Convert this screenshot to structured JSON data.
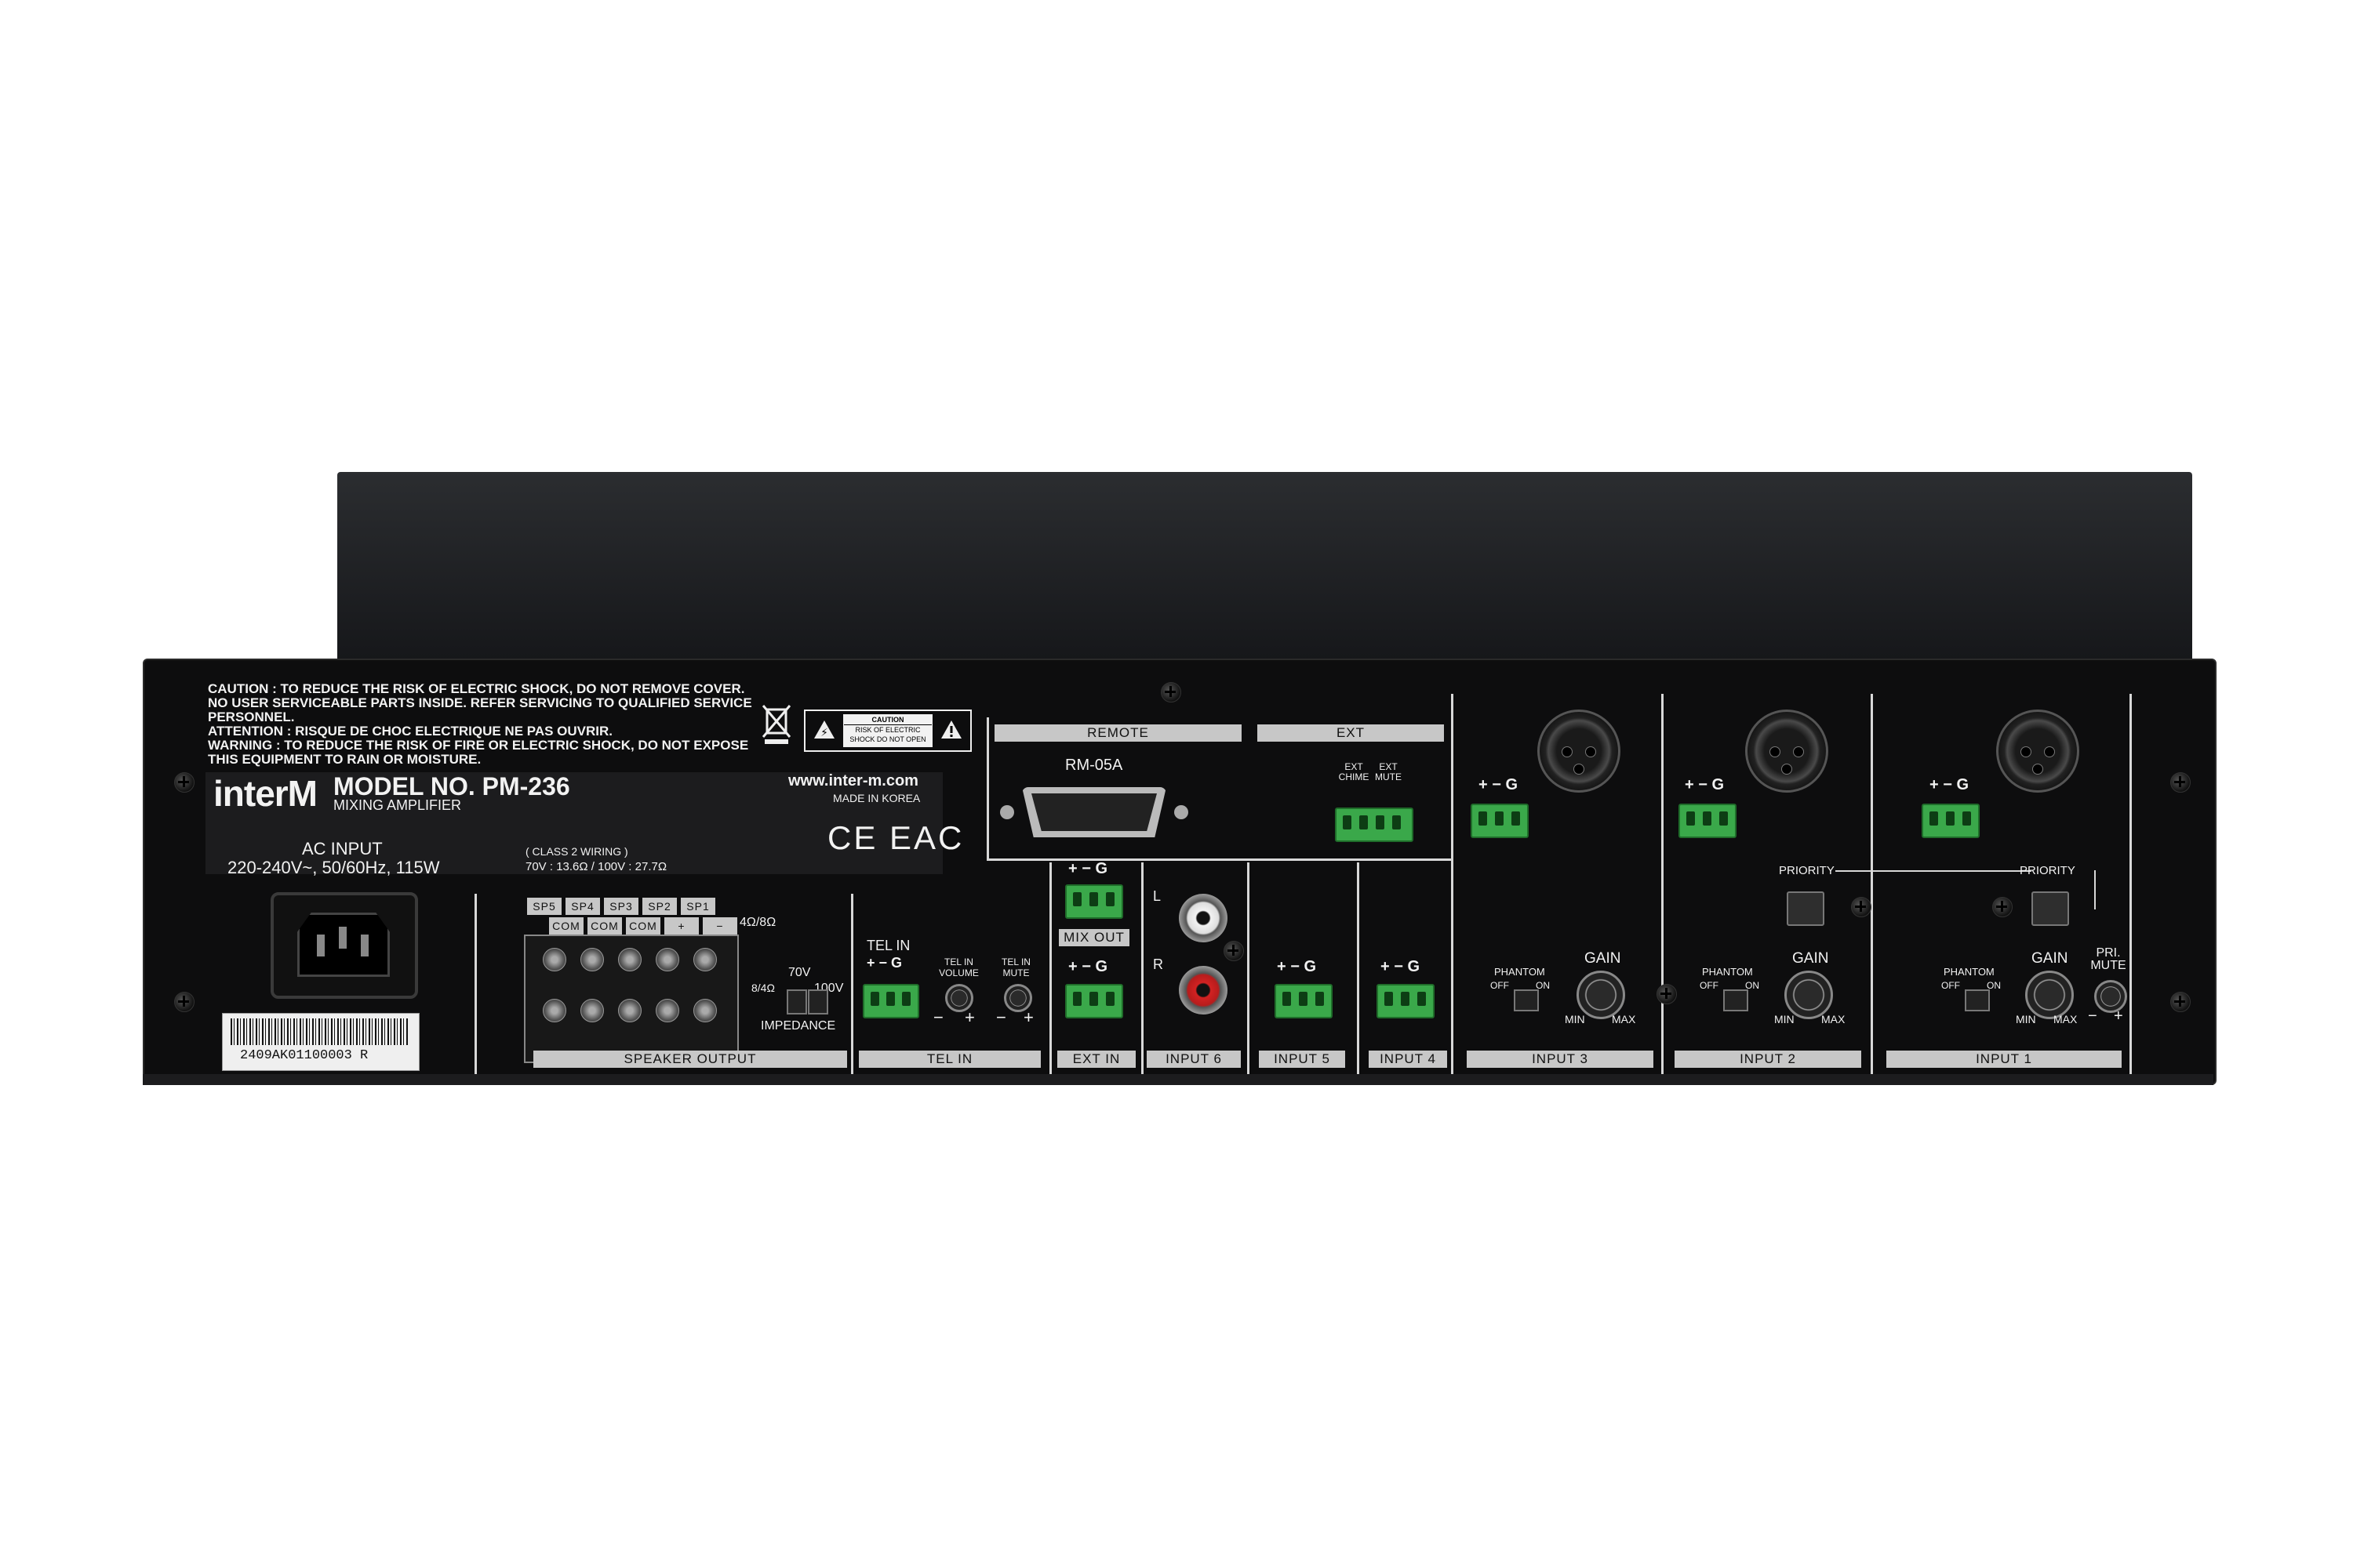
{
  "warnings": {
    "caution": "CAUTION : TO REDUCE THE RISK OF ELECTRIC SHOCK, DO NOT REMOVE COVER. NO USER SERVICEABLE PARTS INSIDE. REFER SERVICING TO QUALIFIED SERVICE PERSONNEL.",
    "attention": "ATTENTION : RISQUE DE CHOC ELECTRIQUE NE PAS OUVRIR.",
    "warning": "WARNING : TO REDUCE THE RISK OF FIRE OR ELECTRIC SHOCK, DO NOT EXPOSE THIS EQUIPMENT TO RAIN OR MOISTURE.",
    "caution_box_title": "CAUTION",
    "caution_box_text": "RISK OF ELECTRIC SHOCK DO NOT OPEN"
  },
  "brand": {
    "logo": "interM",
    "model": "MODEL NO. PM-236",
    "subtitle": "MIXING AMPLIFIER",
    "website": "www.inter-m.com",
    "origin": "MADE IN KOREA",
    "cert": "CE EAC"
  },
  "power": {
    "title": "AC INPUT",
    "spec": "220-240V~, 50/60Hz, 115W",
    "class": "( CLASS 2 WIRING )",
    "impedance_spec": "70V : 13.6Ω / 100V : 27.7Ω"
  },
  "serial": "2409AK01100003  R",
  "speaker": {
    "labels": [
      "SP5",
      "SP4",
      "SP3",
      "SP2",
      "SP1"
    ],
    "com": [
      "COM",
      "COM",
      "COM",
      "+",
      "−"
    ],
    "ohm": "4Ω/8Ω",
    "v70": "70V",
    "v100": "100V",
    "ohm_switch": "8/4Ω",
    "impedance": "IMPEDANCE",
    "section": "SPEAKER OUTPUT"
  },
  "telin": {
    "label": "TEL IN",
    "pins": "+ − G",
    "volume": "TEL IN VOLUME",
    "mute": "TEL IN MUTE",
    "minus": "−",
    "plus": "+",
    "section": "TEL IN"
  },
  "mixout": {
    "pins": "+ − G",
    "label": "MIX OUT"
  },
  "extin": {
    "pins": "+ − G",
    "section": "EXT IN"
  },
  "remote": {
    "section": "REMOTE",
    "port": "RM-05A"
  },
  "ext": {
    "section": "EXT",
    "chime": "EXT CHIME",
    "mute": "EXT MUTE"
  },
  "input6": {
    "left": "L",
    "right": "R",
    "section": "INPUT 6"
  },
  "input5": {
    "pins": "+ − G",
    "section": "INPUT 5"
  },
  "input4": {
    "pins": "+ − G",
    "section": "INPUT 4"
  },
  "input3": {
    "pins": "+ − G",
    "phantom": "PHANTOM",
    "off": "OFF",
    "on": "ON",
    "gain": "GAIN",
    "min": "MIN",
    "max": "MAX",
    "section": "INPUT 3"
  },
  "input2": {
    "pins": "+ − G",
    "phantom": "PHANTOM",
    "off": "OFF",
    "on": "ON",
    "gain": "GAIN",
    "min": "MIN",
    "max": "MAX",
    "priority": "PRIORITY",
    "section": "INPUT 2"
  },
  "input1": {
    "pins": "+ − G",
    "phantom": "PHANTOM",
    "off": "OFF",
    "on": "ON",
    "gain": "GAIN",
    "min": "MIN",
    "max": "MAX",
    "priority": "PRIORITY",
    "primute": "PRI. MUTE",
    "minus": "−",
    "plus": "+",
    "section": "INPUT 1"
  },
  "colors": {
    "terminal_green": "#3aa84a",
    "rca_white": "#f2f2f2",
    "rca_red": "#d22222",
    "panel": "#0d0d0e"
  }
}
